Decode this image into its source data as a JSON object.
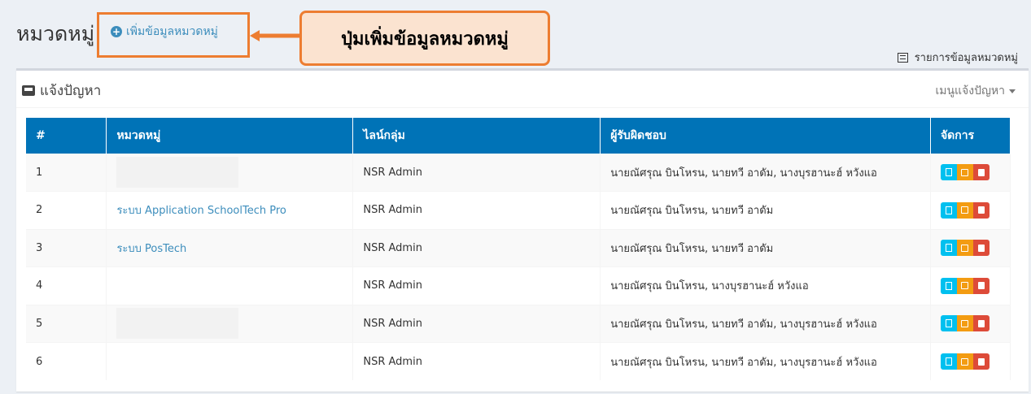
{
  "header": {
    "title": "หมวดหมู่",
    "add_link": "เพิ่มข้อมูลหมวดหมู่",
    "callout": "ปุ่มเพิ่มข้อมูลหมวดหมู่",
    "list_link": "รายการข้อมูลหมวดหมู่"
  },
  "box": {
    "title": "แจ้งปัญหา",
    "menu": "เมนูแจ้งปัญหา"
  },
  "table": {
    "columns": [
      "#",
      "หมวดหมู่",
      "ไลน์กลุ่ม",
      "ผู้รับผิดชอบ",
      "จัดการ"
    ],
    "rows": [
      {
        "num": "1",
        "category": "",
        "line_group": "NSR Admin",
        "responsible": "นายณัศรุณ บินโหรน, นายทวี อาดัม, นางบุรฮานะฮ์ หวังแอ"
      },
      {
        "num": "2",
        "category": "ระบบ Application SchoolTech Pro",
        "line_group": "NSR Admin",
        "responsible": "นายณัศรุณ บินโหรน, นายทวี อาดัม"
      },
      {
        "num": "3",
        "category": "ระบบ PosTech",
        "line_group": "NSR Admin",
        "responsible": "นายณัศรุณ บินโหรน, นายทวี อาดัม"
      },
      {
        "num": "4",
        "category": "",
        "line_group": "NSR Admin",
        "responsible": "นายณัศรุณ บินโหรน, นางบุรฮานะฮ์ หวังแอ"
      },
      {
        "num": "5",
        "category": "",
        "line_group": "NSR Admin",
        "responsible": "นายณัศรุณ บินโหรน, นายทวี อาดัม, นางบุรฮานะฮ์ หวังแอ"
      },
      {
        "num": "6",
        "category": "",
        "line_group": "NSR Admin",
        "responsible": "นายณัศรุณ บินโหรน, นายทวี อาดัม, นางบุรฮานะฮ์ หวังแอ"
      }
    ]
  },
  "icons": {
    "add": "plus-circle-icon",
    "list": "list-icon",
    "box_title": "inbox-icon",
    "view": "file-icon",
    "edit": "edit-icon",
    "delete": "trash-icon"
  },
  "colors": {
    "header_bg": "#0073b7",
    "link": "#3c8dbc",
    "callout_border": "#ed7d31",
    "callout_bg": "#fbe3d0",
    "view_btn": "#00c0ef",
    "edit_btn": "#f39c12",
    "delete_btn": "#dd4b39"
  }
}
